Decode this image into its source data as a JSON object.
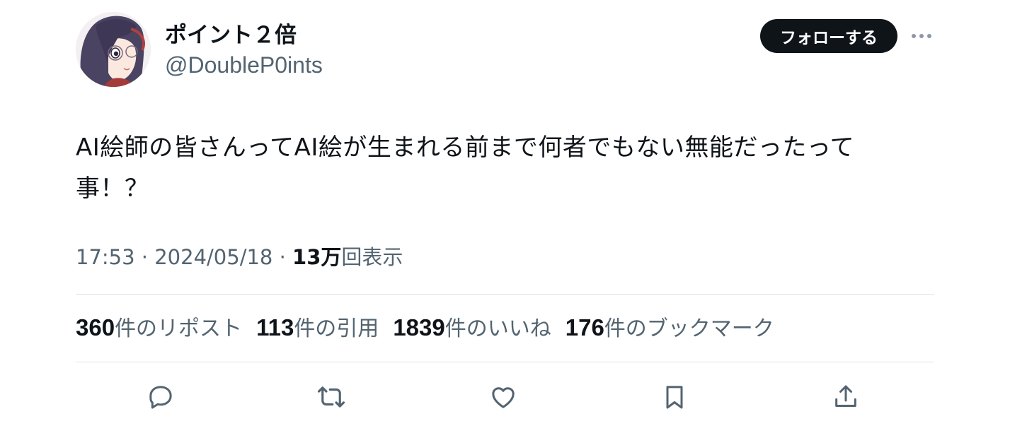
{
  "author": {
    "display_name": "ポイント２倍",
    "handle": "@DoubleP0ints"
  },
  "follow_button_label": "フォローする",
  "tweet": {
    "text": "AI絵師の皆さんってAI絵が生まれる前まで何者でもない無能だったって\n事！？"
  },
  "meta": {
    "time": "17:53",
    "separator": " · ",
    "date": "2024/05/18",
    "views_count": "13万",
    "views_label": "回表示"
  },
  "stats": {
    "reposts_count": "360",
    "reposts_label": "件のリポスト",
    "quotes_count": "113",
    "quotes_label": "件の引用",
    "likes_count": "1839",
    "likes_label": "件のいいね",
    "bookmarks_count": "176",
    "bookmarks_label": "件のブックマーク"
  },
  "actions": {
    "icons": [
      "reply-icon",
      "repost-icon",
      "like-icon",
      "bookmark-icon",
      "share-icon"
    ]
  },
  "colors": {
    "primary_text": "#0f1419",
    "secondary_text": "#536471",
    "divider": "#dfe3e6",
    "follow_button_bg": "#0f1419"
  }
}
